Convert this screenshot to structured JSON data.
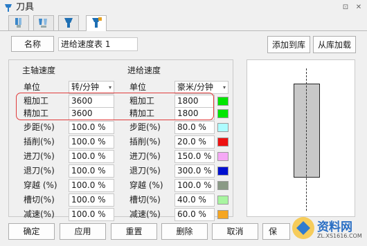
{
  "window": {
    "title": "刀具",
    "pin_glyph": "⊡",
    "close_glyph": "✕"
  },
  "tabs": [
    {
      "name": "tab-tool-1",
      "color": "#3b87c9"
    },
    {
      "name": "tab-tool-2",
      "color": "#3b87c9"
    },
    {
      "name": "tab-tool-3",
      "color": "#1e6fb3"
    },
    {
      "name": "tab-feeds-speeds",
      "color": "#1e6fb3",
      "active": true
    }
  ],
  "header": {
    "name_label": "名称",
    "name_value": "进给速度表 1",
    "add_to_library": "添加到库",
    "load_from_library": "从库加载"
  },
  "spindle": {
    "title": "主轴速度",
    "unit_label": "单位",
    "unit_value": "转/分钟",
    "rough_label": "粗加工",
    "rough_value": "3600",
    "finish_label": "精加工",
    "finish_value": "3600"
  },
  "feed": {
    "title": "进给速度",
    "unit_label": "单位",
    "unit_value": "豪米/分钟",
    "rough_label": "粗加工",
    "rough_value": "1800",
    "rough_color": "#00e600",
    "finish_label": "精加工",
    "finish_value": "1800",
    "finish_color": "#00e600"
  },
  "percent_rows": [
    {
      "label": "步距(%)",
      "spindle": "100.0 %",
      "feed_label": "步距(%)",
      "feed": "80.0 %",
      "color": "#aefcff"
    },
    {
      "label": "插削(%)",
      "spindle": "100.0 %",
      "feed_label": "插削(%)",
      "feed": "20.0 %",
      "color": "#ee1111"
    },
    {
      "label": "进刀(%)",
      "spindle": "100.0 %",
      "feed_label": "进刀(%)",
      "feed": "150.0 %",
      "color": "#f5a8f5"
    },
    {
      "label": "退刀(%)",
      "spindle": "100.0 %",
      "feed_label": "退刀(%)",
      "feed": "300.0 %",
      "color": "#0010d0"
    },
    {
      "label": "穿越 (%)",
      "spindle": "100.0 %",
      "feed_label": "穿越 (%)",
      "feed": "100.0 %",
      "color": "#8a9a86"
    },
    {
      "label": "槽切(%)",
      "spindle": "100.0 %",
      "feed_label": "槽切(%)",
      "feed": "40.0 %",
      "color": "#a8f5a0"
    },
    {
      "label": "减速(%)",
      "spindle": "100.0 %",
      "feed_label": "减速(%)",
      "feed": "60.0 %",
      "color": "#f5a623"
    }
  ],
  "footer": {
    "ok": "确定",
    "apply": "应用",
    "reset": "重置",
    "delete": "删除",
    "cancel": "取消",
    "save": "保"
  },
  "watermark": {
    "text": "资料网",
    "url": "ZL.XS1616.COM"
  }
}
